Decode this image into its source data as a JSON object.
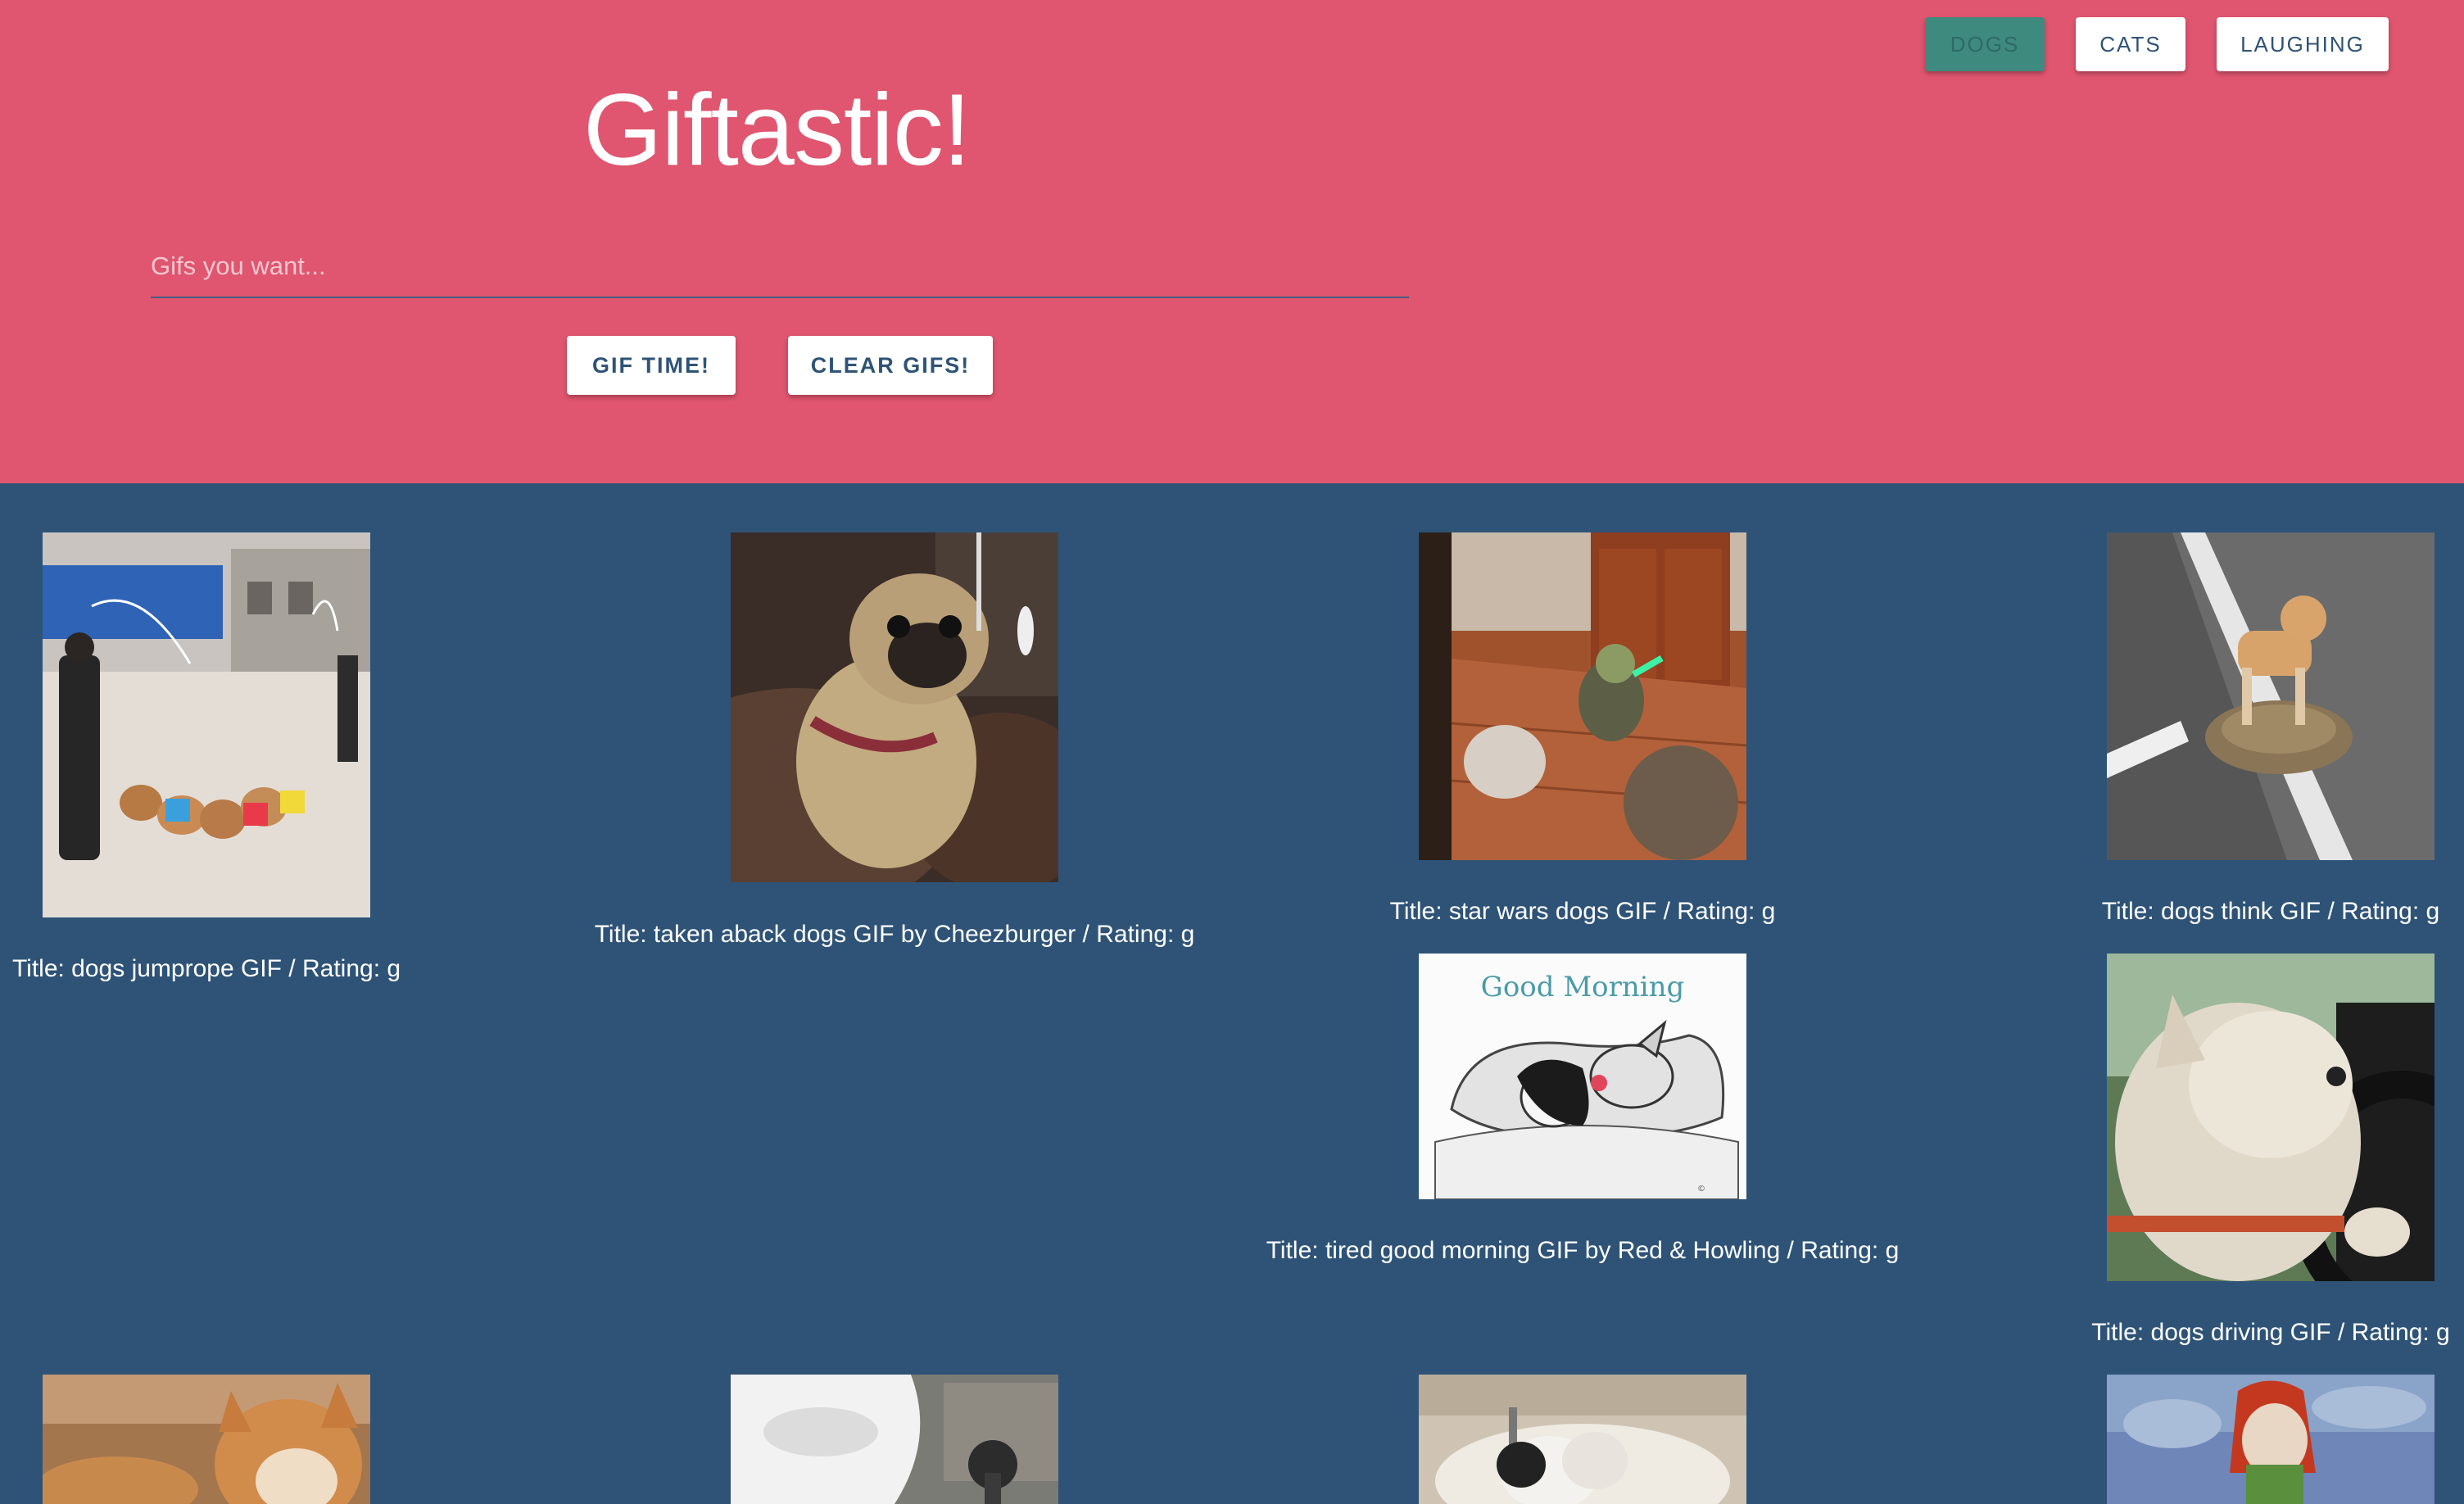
{
  "nav": {
    "buttons": [
      {
        "label": "DOGS"
      },
      {
        "label": "CATS"
      },
      {
        "label": "LAUGHING"
      }
    ]
  },
  "header": {
    "title": "Giftastic!",
    "search_placeholder": "Gifs you want...",
    "gif_button": "GIF TIME!",
    "clear_button": "CLEAR GIFS!"
  },
  "gifs": [
    {
      "caption": "Title: dogs jumprope GIF / Rating: g"
    },
    {
      "caption": "Title: taken aback dogs GIF by Cheezburger / Rating: g"
    },
    {
      "caption": "Title: star wars dogs GIF / Rating: g"
    },
    {
      "caption": "Title: dogs think GIF / Rating: g"
    },
    {
      "caption": "Title: tired good morning GIF by Red & Howling / Rating: g",
      "image_text": "Good Morning"
    },
    {
      "caption": "Title: dogs driving GIF / Rating: g"
    }
  ],
  "colors": {
    "header_bg": "#e0556f",
    "page_bg": "#2e5377",
    "active_nav": "#3f8a7e"
  }
}
